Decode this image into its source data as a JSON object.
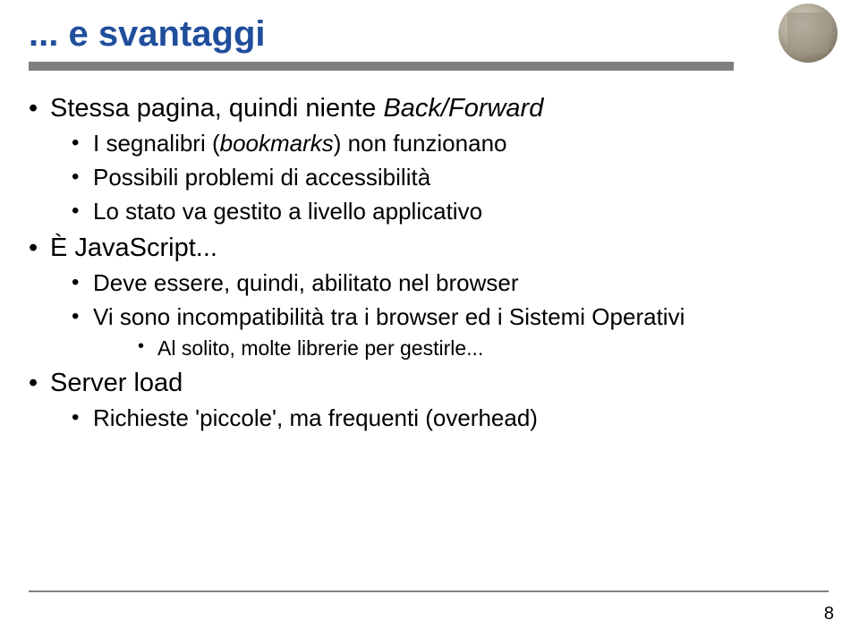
{
  "title": "... e svantaggi",
  "bullets": {
    "b1": {
      "text": "Stessa pagina, quindi niente ",
      "italic": "Back/Forward",
      "sub": {
        "s1_a": "I segnalibri (",
        "s1_b": "bookmarks",
        "s1_c": ") non funzionano",
        "s2": "Possibili problemi di accessibilità",
        "s3": "Lo stato va gestito a livello applicativo"
      }
    },
    "b2": {
      "text": "È JavaScript...",
      "sub": {
        "s1": "Deve essere, quindi, abilitato nel browser",
        "s2": "Vi sono incompatibilità tra i browser ed i Sistemi Operativi",
        "subsub": {
          "ss1": "Al solito, molte librerie per gestirle..."
        }
      }
    },
    "b3": {
      "text": "Server load",
      "sub": {
        "s1": "Richieste 'piccole', ma frequenti (overhead)"
      }
    }
  },
  "page_number": "8"
}
